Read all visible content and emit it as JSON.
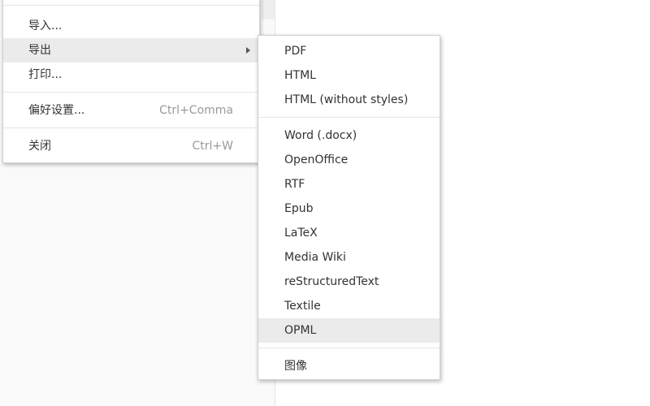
{
  "file_menu": {
    "items": [
      {
        "label": "导入..."
      },
      {
        "label": "导出"
      },
      {
        "label": "打印..."
      },
      {
        "label": "偏好设置...",
        "shortcut": "Ctrl+Comma"
      },
      {
        "label": "关闭",
        "shortcut": "Ctrl+W"
      }
    ],
    "active_item": "导出"
  },
  "export_menu": {
    "group_web": [
      "PDF",
      "HTML",
      "HTML (without styles)"
    ],
    "group_doc": [
      "Word (.docx)",
      "OpenOffice",
      "RTF",
      "Epub",
      "LaTeX",
      "Media Wiki",
      "reStructuredText",
      "Textile",
      "OPML"
    ],
    "group_image": [
      "图像"
    ],
    "highlighted_item": "OPML"
  },
  "colors": {
    "menu_bg": "#ffffff",
    "highlight_bg": "#ebebeb",
    "text": "#333333",
    "shortcut_text": "#9a9a9a",
    "sidebar_bg": "#fafafa"
  }
}
